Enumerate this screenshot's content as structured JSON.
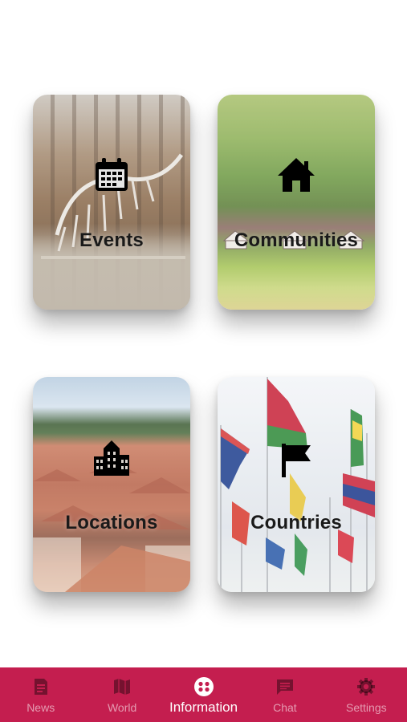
{
  "cards": {
    "events": {
      "label": "Events",
      "icon": "calendar-icon"
    },
    "communities": {
      "label": "Communities",
      "icon": "home-icon"
    },
    "locations": {
      "label": "Locations",
      "icon": "city-icon"
    },
    "countries": {
      "label": "Countries",
      "icon": "flag-icon"
    }
  },
  "tabbar": {
    "active": "information",
    "background": "#c41e4f",
    "tabs": [
      {
        "id": "news",
        "label": "News",
        "icon": "article-icon"
      },
      {
        "id": "world",
        "label": "World",
        "icon": "map-icon"
      },
      {
        "id": "information",
        "label": "Information",
        "icon": "dots-circle-icon"
      },
      {
        "id": "chat",
        "label": "Chat",
        "icon": "chat-icon"
      },
      {
        "id": "settings",
        "label": "Settings",
        "icon": "gear-icon"
      }
    ]
  }
}
